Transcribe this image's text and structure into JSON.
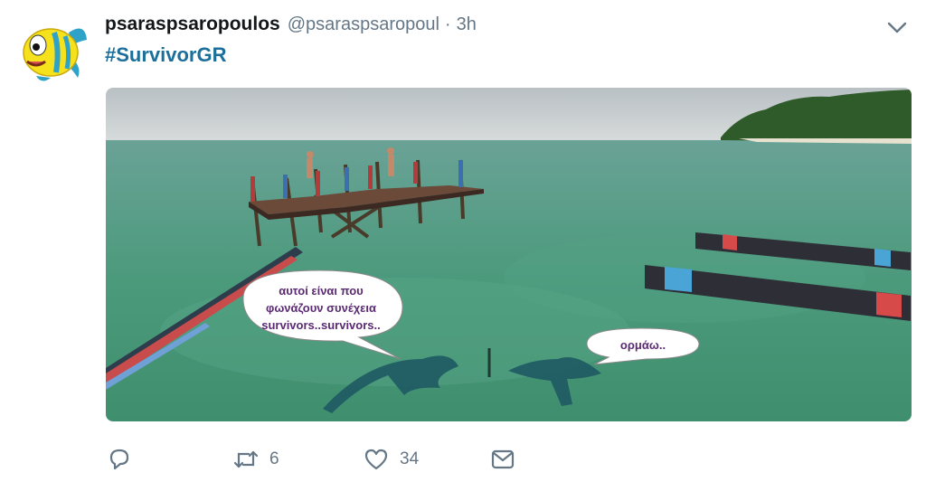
{
  "tweet": {
    "display_name": "psaraspsaropoulos",
    "handle": "@psaraspsaropoul",
    "separator": "·",
    "time": "3h",
    "hashtag": "#SurvivorGR",
    "avatar_icon": "yellow-fish-avatar",
    "menu_icon": "chevron-down-icon"
  },
  "media": {
    "speech_bubble_1": {
      "line1": "αυτοί είναι που",
      "line2": "φωνάζουν συνέχεια",
      "line3": "survivors..survivors.."
    },
    "speech_bubble_2": {
      "line1": "ορμάω.."
    }
  },
  "actions": {
    "reply": {
      "icon": "reply-icon",
      "count": ""
    },
    "retweet": {
      "icon": "retweet-icon",
      "count": "6"
    },
    "like": {
      "icon": "heart-icon",
      "count": "34"
    },
    "message": {
      "icon": "direct-message-icon",
      "count": ""
    }
  },
  "colors": {
    "hashtag": "#1b6f9a",
    "secondary_text": "#657786",
    "water": "#3f8f73"
  }
}
